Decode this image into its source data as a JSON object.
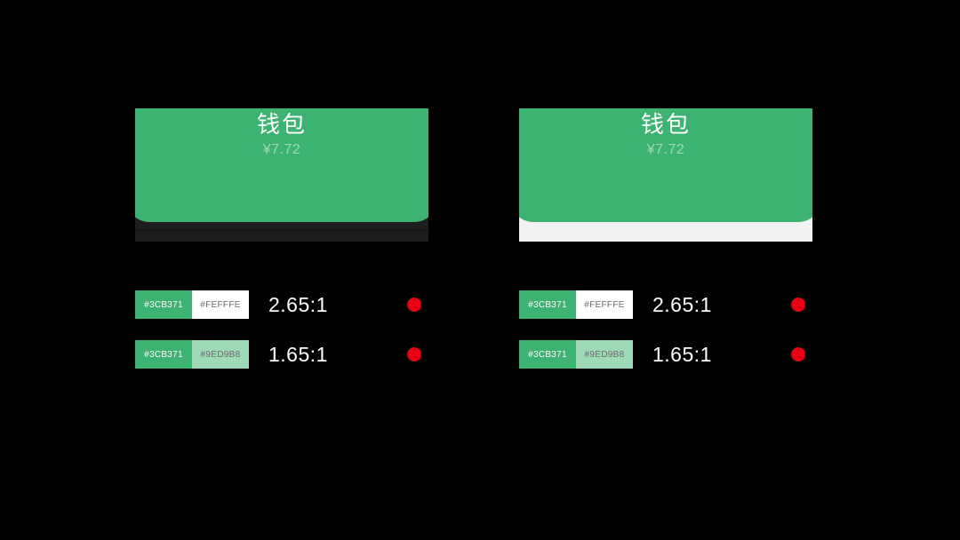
{
  "colors": {
    "accent": "#3cb371",
    "accentText": "#fefffe",
    "accentSub": "#9ed9b8",
    "fail": "#e60012"
  },
  "card": {
    "title": "钱包",
    "amount": "¥7.72"
  },
  "panels": [
    {
      "mode": "dark"
    },
    {
      "mode": "light"
    }
  ],
  "rows": [
    {
      "swatches": [
        {
          "hex": "#3CB371",
          "bg": "#3cb371",
          "fg": "#ffffff"
        },
        {
          "hex": "#FEFFFE",
          "bg": "#fefffe",
          "fg": "#6b6b6b"
        }
      ],
      "ratio": "2.65:1",
      "pass": false
    },
    {
      "swatches": [
        {
          "hex": "#3CB371",
          "bg": "#3cb371",
          "fg": "#ffffff"
        },
        {
          "hex": "#9ED9B8",
          "bg": "#9ed9b8",
          "fg": "#6b6b6b"
        }
      ],
      "ratio": "1.65:1",
      "pass": false
    }
  ]
}
